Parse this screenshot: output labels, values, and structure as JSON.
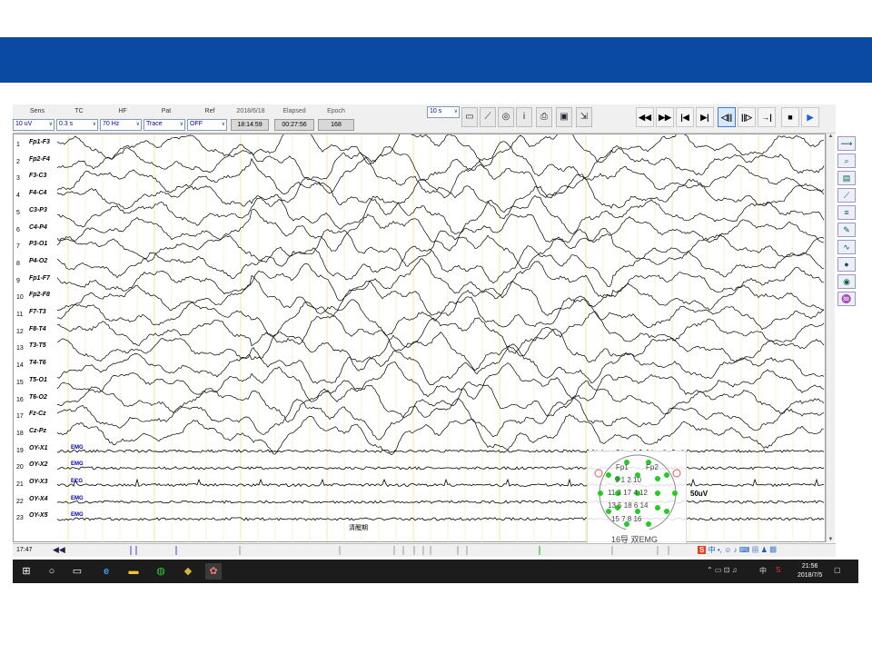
{
  "controls": {
    "sens_label": "Sens",
    "sens_value": "10 uV",
    "tc_label": "TC",
    "tc_value": "0.3 s",
    "hf_label": "HF",
    "hf_value": "70 Hz",
    "pat_label": "Pat",
    "pat_value": "Trace",
    "ref_label": "Ref",
    "ref_value": "OFF",
    "date": "2018/6/18",
    "clock_time": "18:14:59",
    "elapsed_label": "Elapsed",
    "elapsed_value": "00:27:56",
    "epoch_label": "Epoch",
    "epoch_value": "168",
    "timebase_value": "10 s"
  },
  "channels": [
    {
      "num": "1",
      "name": "Fp1-F3",
      "tag": ""
    },
    {
      "num": "2",
      "name": "Fp2-F4",
      "tag": ""
    },
    {
      "num": "3",
      "name": "F3-C3",
      "tag": ""
    },
    {
      "num": "4",
      "name": "F4-C4",
      "tag": ""
    },
    {
      "num": "5",
      "name": "C3-P3",
      "tag": ""
    },
    {
      "num": "6",
      "name": "C4-P4",
      "tag": ""
    },
    {
      "num": "7",
      "name": "P3-O1",
      "tag": ""
    },
    {
      "num": "8",
      "name": "P4-O2",
      "tag": ""
    },
    {
      "num": "9",
      "name": "Fp1-F7",
      "tag": ""
    },
    {
      "num": "10",
      "name": "Fp2-F8",
      "tag": ""
    },
    {
      "num": "11",
      "name": "F7-T3",
      "tag": ""
    },
    {
      "num": "12",
      "name": "F8-T4",
      "tag": ""
    },
    {
      "num": "13",
      "name": "T3-T5",
      "tag": ""
    },
    {
      "num": "14",
      "name": "T4-T6",
      "tag": ""
    },
    {
      "num": "15",
      "name": "T5-O1",
      "tag": ""
    },
    {
      "num": "16",
      "name": "T6-O2",
      "tag": ""
    },
    {
      "num": "17",
      "name": "Fz-Cz",
      "tag": ""
    },
    {
      "num": "18",
      "name": "Cz-Pz",
      "tag": ""
    },
    {
      "num": "19",
      "name": "OY-X1",
      "tag": "EMG"
    },
    {
      "num": "20",
      "name": "OY-X2",
      "tag": "EMG"
    },
    {
      "num": "21",
      "name": "OY-X3",
      "tag": "ECG"
    },
    {
      "num": "22",
      "name": "OY-X4",
      "tag": "EMG"
    },
    {
      "num": "23",
      "name": "OY-X5",
      "tag": "EMG"
    }
  ],
  "annotations": {
    "sleep_stage": "清醒期",
    "scale": "50uV"
  },
  "headmap": {
    "fp1": "Fp1",
    "fp2": "Fp2",
    "caption": "16导 双EMG",
    "row1": "9 1   2 10",
    "row2": "11 3 17 4 12",
    "row3": "13 5 18 6 14",
    "row4": "15 7   8 16"
  },
  "timeline": {
    "time": "17:47"
  },
  "ime": {
    "text": "中"
  },
  "taskbar": {
    "tray_lang": "中",
    "time": "21:56",
    "date": "2018/7/5"
  },
  "colors": {
    "banner": "#0b4aa2",
    "trace": "#000000",
    "emg_tag": "#0000aa",
    "electrode": "#22cc22"
  }
}
